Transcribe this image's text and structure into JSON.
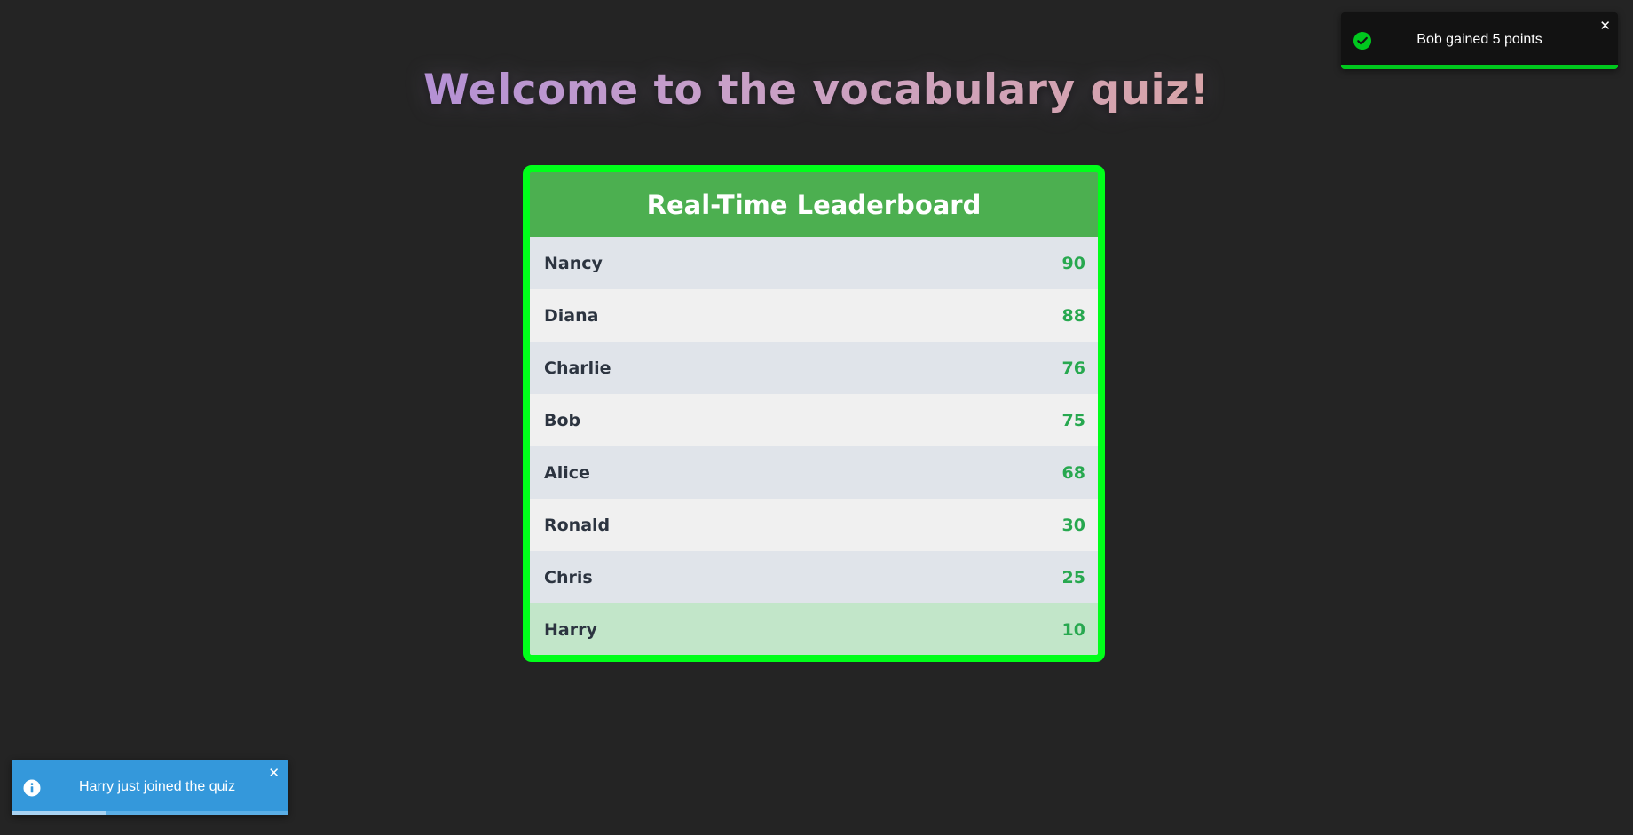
{
  "page": {
    "title": "Welcome to the vocabulary quiz!"
  },
  "leaderboard": {
    "title": "Real-Time Leaderboard",
    "rows": [
      {
        "name": "Nancy",
        "score": "90"
      },
      {
        "name": "Diana",
        "score": "88"
      },
      {
        "name": "Charlie",
        "score": "76"
      },
      {
        "name": "Bob",
        "score": "75"
      },
      {
        "name": "Alice",
        "score": "68"
      },
      {
        "name": "Ronald",
        "score": "30"
      },
      {
        "name": "Chris",
        "score": "25"
      },
      {
        "name": "Harry",
        "score": "10"
      }
    ],
    "highlighted_player": "Harry"
  },
  "toasts": {
    "success": {
      "message": "Bob gained 5 points",
      "icon": "check-circle-icon",
      "close_symbol": "✕",
      "progress": 1.0,
      "accent_color": "#00c81e"
    },
    "info": {
      "message": "Harry just joined the quiz",
      "icon": "info-circle-icon",
      "close_symbol": "✕",
      "progress": 0.34,
      "accent_color": "#3498db"
    }
  },
  "colors": {
    "background": "#242424",
    "board_border": "#00ff1a",
    "board_header": "#4caf50",
    "score_text": "#27a84f",
    "highlight_row": "#c2e6c9"
  }
}
